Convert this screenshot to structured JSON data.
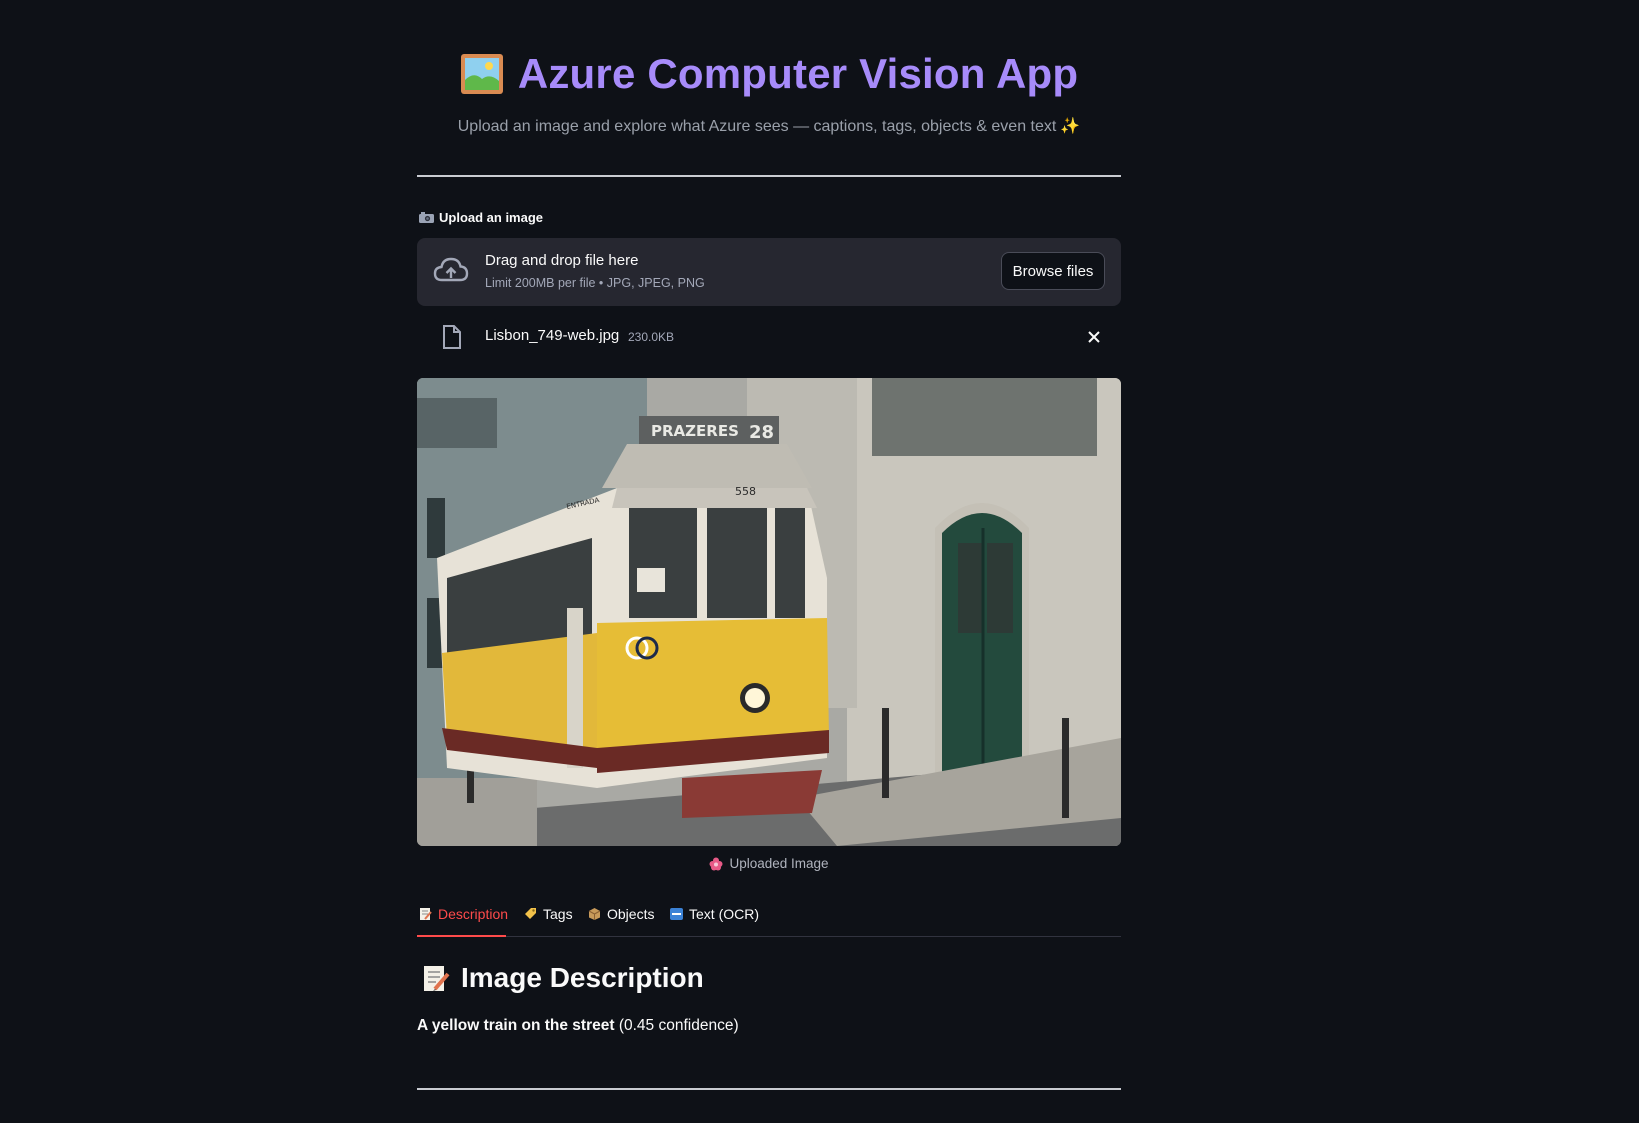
{
  "header": {
    "title": "Azure Computer Vision App",
    "subtitle": "Upload an image and explore what Azure sees — captions, tags, objects & even text",
    "title_icon": "framed-picture-icon",
    "subtitle_icon": "sparkles-icon"
  },
  "upload": {
    "label": "Upload an image",
    "label_icon": "camera-icon",
    "drop_title": "Drag and drop file here",
    "drop_limit": "Limit 200MB per file • JPG, JPEG, PNG",
    "browse_label": "Browse files"
  },
  "file": {
    "name": "Lisbon_749-web.jpg",
    "size": "230.0KB"
  },
  "image": {
    "sign_text": "PRAZERES",
    "route_number": "28",
    "car_number": "558",
    "entrada": "ENTRADA",
    "caption": "Uploaded Image",
    "caption_icon": "flower-icon"
  },
  "tabs": [
    {
      "label": "Description",
      "icon": "memo-icon",
      "active": true
    },
    {
      "label": "Tags",
      "icon": "label-tag-icon",
      "active": false
    },
    {
      "label": "Objects",
      "icon": "package-icon",
      "active": false
    },
    {
      "label": "Text (OCR)",
      "icon": "abc-icon",
      "active": false
    }
  ],
  "description": {
    "heading": "Image Description",
    "caption_text": "A yellow train on the street",
    "confidence_text": "(0.45 confidence)"
  },
  "colors": {
    "background": "#0e1117",
    "title": "#a78bfa",
    "accent": "#ff4b4b",
    "panel": "#262730"
  }
}
